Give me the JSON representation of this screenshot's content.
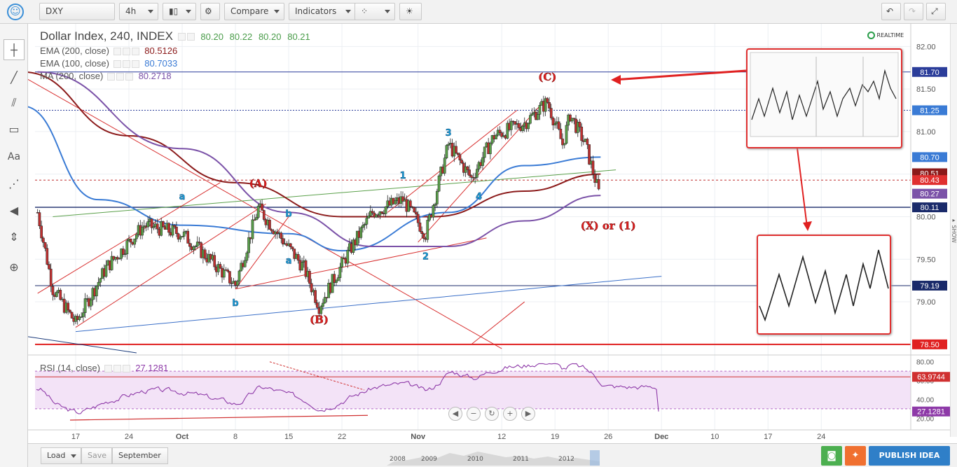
{
  "toolbar": {
    "symbol": "DXY",
    "interval": "4h",
    "compare_label": "Compare",
    "indicators_label": "Indicators"
  },
  "legend": {
    "title": "Dollar Index, 240, INDEX",
    "ohlc": [
      "80.20",
      "80.22",
      "80.20",
      "80.21"
    ],
    "ema200_label": "EMA (200, close)",
    "ema200_value": "80.5126",
    "ema100_label": "EMA (100, close)",
    "ema100_value": "80.7033",
    "ma200_label": "MA (200, close)",
    "ma200_value": "80.2718",
    "realtime": "REALTIME"
  },
  "rsi": {
    "label": "RSI (14, close)",
    "value": "27.1281",
    "ticks": [
      "80.00",
      "60.00",
      "40.00",
      "20.00"
    ],
    "badges": [
      "63.9744",
      "27.1281"
    ]
  },
  "colors": {
    "ema200": "#8b1a1a",
    "ema100": "#3a7bd5",
    "ma200": "#7b52a8",
    "annotation": "#e02020",
    "wave_label": "#1ca0d8",
    "rsi_line": "#8e3aa8"
  },
  "chart_data": {
    "type": "candlestick",
    "title": "Dollar Index, 240, INDEX",
    "ylim": [
      78.4,
      82.2
    ],
    "y_ticks": [
      "82.00",
      "81.50",
      "81.00",
      "80.50",
      "80.00",
      "79.50",
      "79.00"
    ],
    "x_ticks": [
      "17",
      "24",
      "Oct",
      "8",
      "15",
      "22",
      "Nov",
      "12",
      "19",
      "26",
      "Dec",
      "10",
      "17",
      "24"
    ],
    "price_badges": [
      "81.70",
      "81.25",
      "80.70",
      "80.51",
      "80.43",
      "80.27",
      "80.11",
      "79.19",
      "78.50"
    ],
    "price_points": [
      {
        "d": "Sep 12",
        "p": 80.05
      },
      {
        "d": "Sep 14",
        "p": 79.15
      },
      {
        "d": "Sep 17",
        "p": 78.75
      },
      {
        "d": "Sep 21",
        "p": 79.4
      },
      {
        "d": "Sep 26",
        "p": 79.9
      },
      {
        "d": "Oct 1",
        "p": 79.8
      },
      {
        "d": "Oct 4",
        "p": 79.55
      },
      {
        "d": "Oct 8",
        "p": 79.2
      },
      {
        "d": "Oct 11",
        "p": 80.1
      },
      {
        "d": "Oct 14",
        "p": 79.75
      },
      {
        "d": "Oct 17",
        "p": 79.4
      },
      {
        "d": "Oct 19",
        "p": 78.95
      },
      {
        "d": "Oct 23",
        "p": 79.6
      },
      {
        "d": "Oct 26",
        "p": 80.05
      },
      {
        "d": "Oct 30",
        "p": 80.2
      },
      {
        "d": "Nov 2",
        "p": 79.8
      },
      {
        "d": "Nov 5",
        "p": 80.85
      },
      {
        "d": "Nov 8",
        "p": 80.45
      },
      {
        "d": "Nov 11",
        "p": 80.95
      },
      {
        "d": "Nov 15",
        "p": 81.1
      },
      {
        "d": "Nov 18",
        "p": 81.35
      },
      {
        "d": "Nov 20",
        "p": 80.85
      },
      {
        "d": "Nov 21",
        "p": 81.2
      },
      {
        "d": "Nov 23",
        "p": 80.85
      },
      {
        "d": "Nov 25",
        "p": 80.2
      }
    ],
    "ema200_points": [
      {
        "d": "Sep 10",
        "p": 81.7
      },
      {
        "d": "Sep 24",
        "p": 80.95
      },
      {
        "d": "Oct 8",
        "p": 80.4
      },
      {
        "d": "Oct 22",
        "p": 80.0
      },
      {
        "d": "Nov 3",
        "p": 80.0
      },
      {
        "d": "Nov 15",
        "p": 80.3
      },
      {
        "d": "Nov 25",
        "p": 80.5
      }
    ],
    "ema100_points": [
      {
        "d": "Sep 10",
        "p": 81.3
      },
      {
        "d": "Sep 20",
        "p": 80.2
      },
      {
        "d": "Oct 1",
        "p": 79.9
      },
      {
        "d": "Oct 15",
        "p": 79.8
      },
      {
        "d": "Oct 22",
        "p": 79.6
      },
      {
        "d": "Nov 5",
        "p": 80.05
      },
      {
        "d": "Nov 15",
        "p": 80.6
      },
      {
        "d": "Nov 25",
        "p": 80.7
      }
    ],
    "ma200_points": [
      {
        "d": "Sep 12",
        "p": 81.7
      },
      {
        "d": "Oct 1",
        "p": 80.8
      },
      {
        "d": "Oct 15",
        "p": 80.05
      },
      {
        "d": "Oct 26",
        "p": 79.65
      },
      {
        "d": "Nov 5",
        "p": 79.65
      },
      {
        "d": "Nov 15",
        "p": 79.95
      },
      {
        "d": "Nov 25",
        "p": 80.25
      }
    ],
    "wave_labels": [
      {
        "text": "a",
        "d": "Oct 1",
        "p": 80.2
      },
      {
        "text": "b",
        "d": "Oct 8",
        "p": 78.95
      },
      {
        "text": "b",
        "d": "Oct 15",
        "p": 80.0
      },
      {
        "text": "a",
        "d": "Oct 15",
        "p": 79.45
      },
      {
        "text": "1",
        "d": "Oct 30",
        "p": 80.45
      },
      {
        "text": "2",
        "d": "Nov 2",
        "p": 79.5
      },
      {
        "text": "3",
        "d": "Nov 5",
        "p": 80.95
      },
      {
        "text": "4",
        "d": "Nov 9",
        "p": 80.2
      }
    ],
    "annotations": [
      {
        "text": "(A)",
        "d": "Oct 11",
        "p": 80.35
      },
      {
        "text": "(B)",
        "d": "Oct 19",
        "p": 78.75
      },
      {
        "text": "(C)",
        "d": "Nov 18",
        "p": 81.6
      },
      {
        "text": "(X) or (1)",
        "d": "Nov 26",
        "p": 79.85
      }
    ]
  },
  "nav": {
    "btns": [
      "◀",
      "−",
      "↻",
      "+",
      "▶"
    ]
  },
  "bottom": {
    "load": "Load",
    "save": "Save",
    "range": "September",
    "years": [
      "2008",
      "2009",
      "2010",
      "2011",
      "2012"
    ],
    "publish": "PUBLISH IDEA"
  },
  "sidebar": {
    "icons": [
      "crosshair-icon",
      "trendline-icon",
      "pitchfork-icon",
      "rectangle-icon",
      "text-icon",
      "pattern-icon",
      "arrow-icon",
      "measure-icon",
      "zoom-icon"
    ]
  }
}
